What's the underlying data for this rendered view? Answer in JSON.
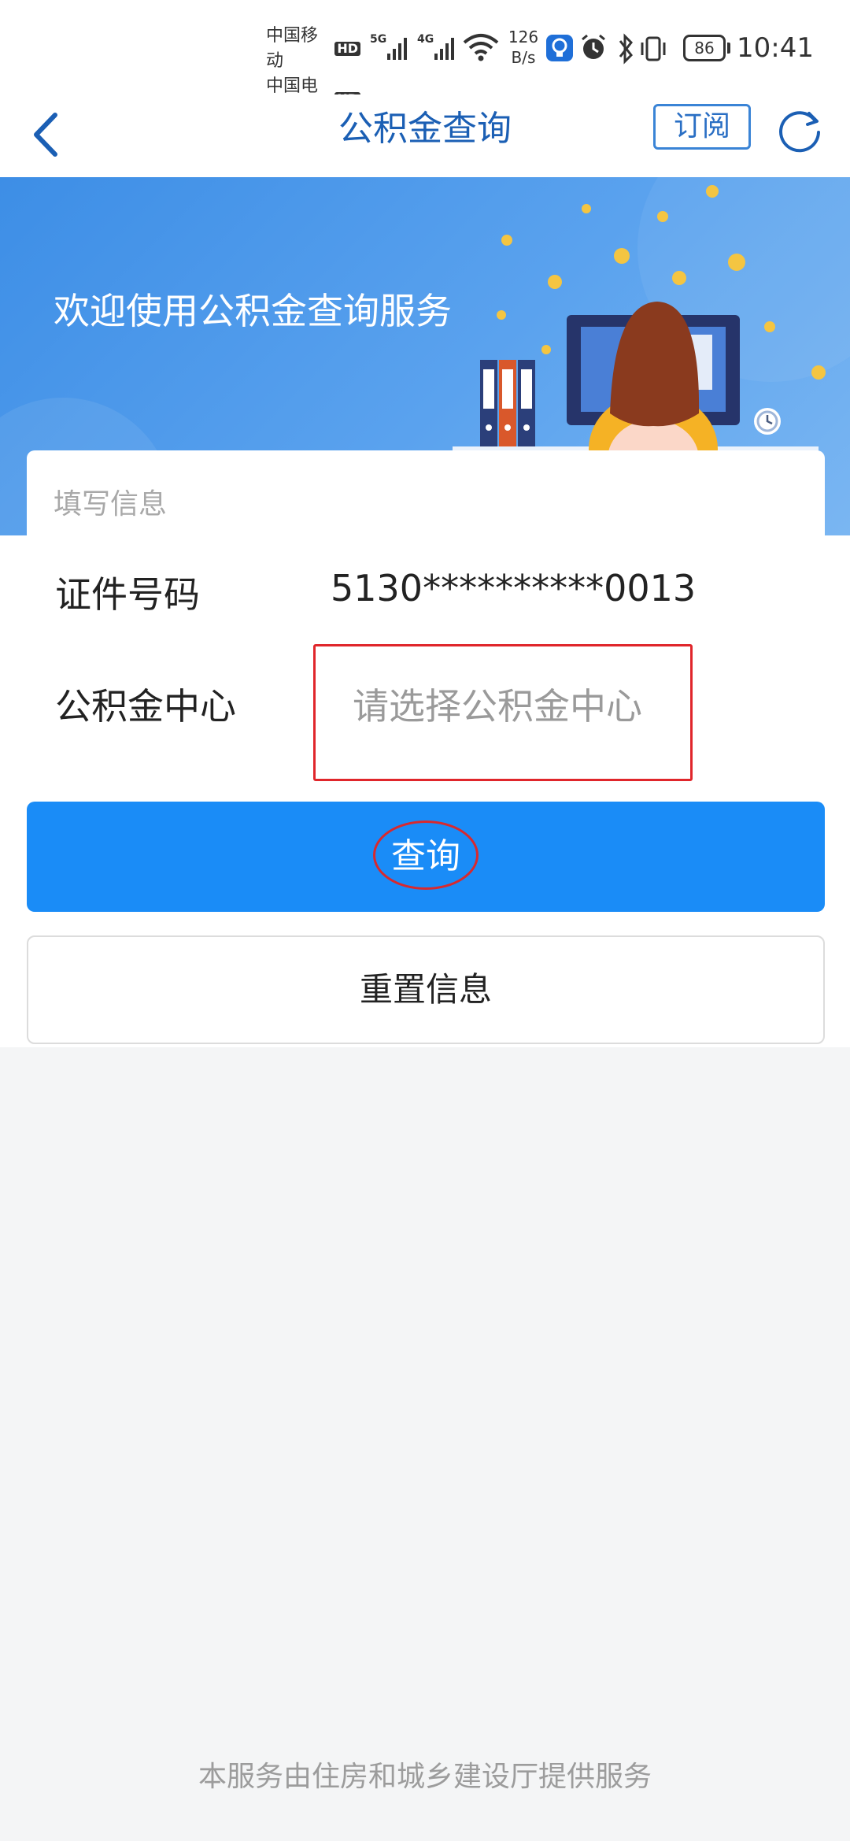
{
  "status_bar": {
    "carrier_1": "中国移动",
    "carrier_2": "中国电信",
    "hd_label": "HD",
    "net_5g": "5G",
    "net_4g": "4G",
    "speed_value": "126",
    "speed_unit": "B/s",
    "battery": "86",
    "time": "10:41"
  },
  "nav": {
    "title": "公积金查询",
    "subscribe_label": "订阅"
  },
  "banner": {
    "title": "欢迎使用公积金查询服务"
  },
  "form": {
    "section_title": "填写信息",
    "id_label": "证件号码",
    "id_value": "5130**********0013",
    "center_label": "公积金中心",
    "center_placeholder": "请选择公积金中心"
  },
  "actions": {
    "query_label": "查询",
    "reset_label": "重置信息"
  },
  "footer": {
    "text": "本服务由住房和城乡建设厅提供服务"
  },
  "colors": {
    "primary": "#1a8cf7",
    "title_blue": "#1b5fb4",
    "highlight_red": "#e0262b"
  }
}
